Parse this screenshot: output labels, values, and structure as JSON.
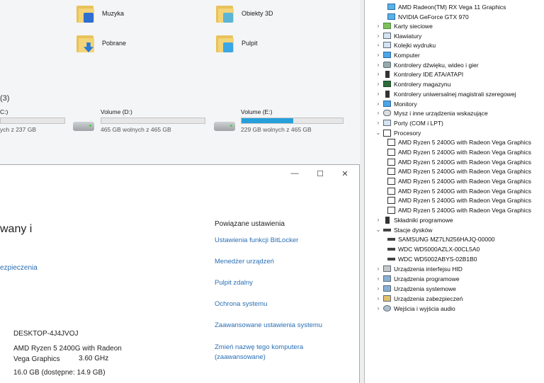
{
  "explorer": {
    "folders": [
      {
        "label": "Muzyka",
        "icon": "music-folder-icon"
      },
      {
        "label": "Obiekty 3D",
        "icon": "3d-objects-folder-icon"
      },
      {
        "label": "Pobrane",
        "icon": "downloads-folder-icon"
      },
      {
        "label": "Pulpit",
        "icon": "desktop-folder-icon"
      }
    ],
    "section_header": "(3)",
    "drives": [
      {
        "name": "C:)",
        "free": "ych z 237 GB",
        "used_fraction": 0.0
      },
      {
        "name": "Volume (D:)",
        "free": "465 GB wolnych z 465 GB",
        "used_fraction": 0.0
      },
      {
        "name": "Volume (E:)",
        "free": "229 GB wolnych z 465 GB",
        "used_fraction": 0.51
      }
    ],
    "accent": "#26a0da"
  },
  "system": {
    "heading_fragment": "wany i",
    "security_link": "ezpieczenia",
    "related_title": "Powiązane ustawienia",
    "related_links": [
      "Ustawienia funkcji BitLocker",
      "Menedżer urządzeń",
      "Pulpit zdalny",
      "Ochrona systemu",
      "Zaawansowane ustawienia systemu",
      "Zmień nazwę tego komputera",
      "(zaawansowane)"
    ],
    "device_name": "DESKTOP-4J4JVOJ",
    "processor_line1": "AMD Ryzen 5 2400G with Radeon",
    "processor_line2": "Vega Graphics",
    "processor_speed": "3.60 GHz",
    "ram": "16.0 GB (dostępne: 14.9 GB)",
    "window_controls": {
      "minimize": "—",
      "maximize": "☐",
      "close": "✕"
    },
    "link_color": "#2a6fb5"
  },
  "device_manager": {
    "gpus": [
      "AMD Radeon(TM) RX Vega 11 Graphics",
      "NVIDIA GeForce GTX 970"
    ],
    "categories_top": [
      "Karty sieciowe",
      "Klawiatury",
      "Kolejki wydruku",
      "Komputer",
      "Kontrolery dźwięku, wideo i gier",
      "Kontrolery IDE ATA/ATAPI",
      "Kontrolery magazynu",
      "Kontrolery uniwersalnej magistrali szeregowej",
      "Monitory",
      "Mysz i inne urządzenia wskazujące",
      "Porty (COM i LPT)",
      "Procesory"
    ],
    "processors": [
      "AMD Ryzen 5 2400G with Radeon Vega Graphics",
      "AMD Ryzen 5 2400G with Radeon Vega Graphics",
      "AMD Ryzen 5 2400G with Radeon Vega Graphics",
      "AMD Ryzen 5 2400G with Radeon Vega Graphics",
      "AMD Ryzen 5 2400G with Radeon Vega Graphics",
      "AMD Ryzen 5 2400G with Radeon Vega Graphics",
      "AMD Ryzen 5 2400G with Radeon Vega Graphics",
      "AMD Ryzen 5 2400G with Radeon Vega Graphics"
    ],
    "categories_mid": [
      "Składniki programowe",
      "Stacje dysków"
    ],
    "disks": [
      "SAMSUNG MZ7LN256HAJQ-00000",
      "WDC WD5000AZLX-00CL5A0",
      "WDC WD5002ABYS-02B1B0"
    ],
    "categories_bottom": [
      "Urządzenia interfejsu HID",
      "Urządzenia programowe",
      "Urządzenia systemowe",
      "Urządzenia zabezpieczeń",
      "Wejścia i wyjścia audio"
    ],
    "chevron_collapsed": "›",
    "chevron_expanded": "⌄"
  }
}
